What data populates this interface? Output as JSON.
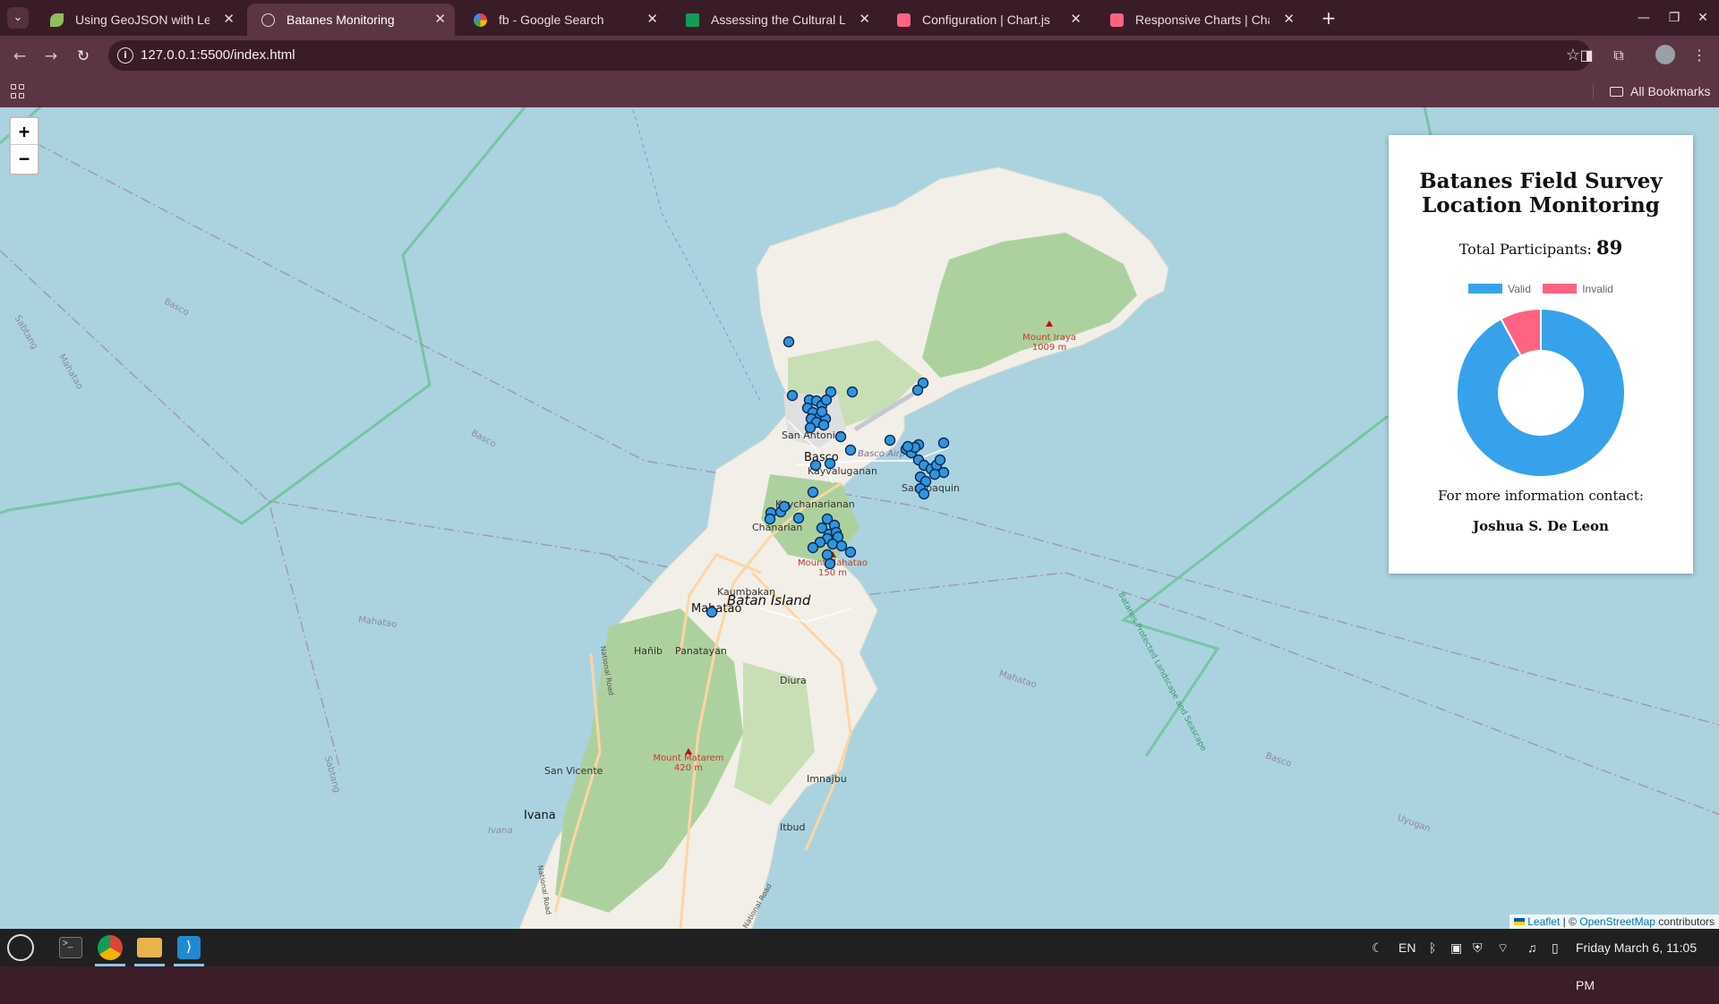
{
  "browser": {
    "tabs": [
      {
        "title": "Using GeoJSON with Leaflet",
        "icon": "leaf-icon",
        "color": "#8fbf5a"
      },
      {
        "title": "Batanes Monitoring",
        "icon": "globe-icon",
        "color": "#c9b3bd",
        "active": true
      },
      {
        "title": "fb - Google Search",
        "icon": "google-icon",
        "color": "#4285f4"
      },
      {
        "title": "Assessing the Cultural Lands",
        "icon": "sheets-icon",
        "color": "#0f9d58"
      },
      {
        "title": "Configuration | Chart.js",
        "icon": "chartjs-icon",
        "color": "#ff6384"
      },
      {
        "title": "Responsive Charts | Chart.js",
        "icon": "chartjs-icon",
        "color": "#ff6384"
      }
    ],
    "url": "127.0.0.1:5500/index.html",
    "all_bookmarks": "All Bookmarks"
  },
  "map": {
    "labels": {
      "island": "Batan Island",
      "basco": "Basco",
      "san_antonio": "San Antonio",
      "airport": "Basco Airport",
      "kayvaluganan": "Kayvaluganan",
      "san_joaquin": "San Joaquin",
      "kaychanarianan": "Kaychanarianan",
      "chanarian": "Chanarian",
      "kaumbakan": "Kaumbakan",
      "mahatao": "Mahatao",
      "hanib": "Hañib",
      "panatayan": "Panatayan",
      "diura": "Diura",
      "san_vicente": "San Vicente",
      "imnajbu": "Imnajbu",
      "ivana": "Ivana",
      "itbud": "Itbud",
      "sea_basco_1": "Basco",
      "sea_basco_2": "Basco",
      "sea_basco_3": "Basco",
      "sea_mahatao_1": "Mahatao",
      "sea_mahatao_2": "Mahatao",
      "sea_mahatao_3": "Mahatao",
      "sea_sabtang_1": "Sabtang",
      "sea_sabtang_2": "Sabtang",
      "sea_ivana": "Ivana",
      "sea_uyugan": "Uyugan",
      "national_road_1": "National Road",
      "national_road_2": "National Road",
      "national_road_3": "National Road",
      "protected": "Batanes Protected Landscape and Seascape"
    },
    "peaks": [
      {
        "name": "Mount Iraya",
        "elevation": "1009 m"
      },
      {
        "name": "Mount Mahatao",
        "elevation": "150 m"
      },
      {
        "name": "Mount Matarem",
        "elevation": "420 m"
      }
    ],
    "zoom_in": "+",
    "zoom_out": "−",
    "attribution": {
      "leaflet": "Leaflet",
      "sep": " | © ",
      "osm": "OpenStreetMap",
      "suffix": " contributors"
    }
  },
  "panel": {
    "title_line1": "Batanes Field Survey",
    "title_line2": "Location Monitoring",
    "total_label": "Total Participants:",
    "total_value": "89",
    "contact_label": "For more information contact:",
    "contact_name": "Joshua S. De Leon"
  },
  "chart_data": {
    "type": "pie",
    "variant": "doughnut",
    "categories": [
      "Valid",
      "Invalid"
    ],
    "values": [
      82,
      7
    ],
    "colors": [
      "#36a2eb",
      "#ff6384"
    ],
    "legend": "top"
  },
  "taskbar": {
    "lang": "EN",
    "clock": "Friday March 6, 11:05 PM"
  }
}
